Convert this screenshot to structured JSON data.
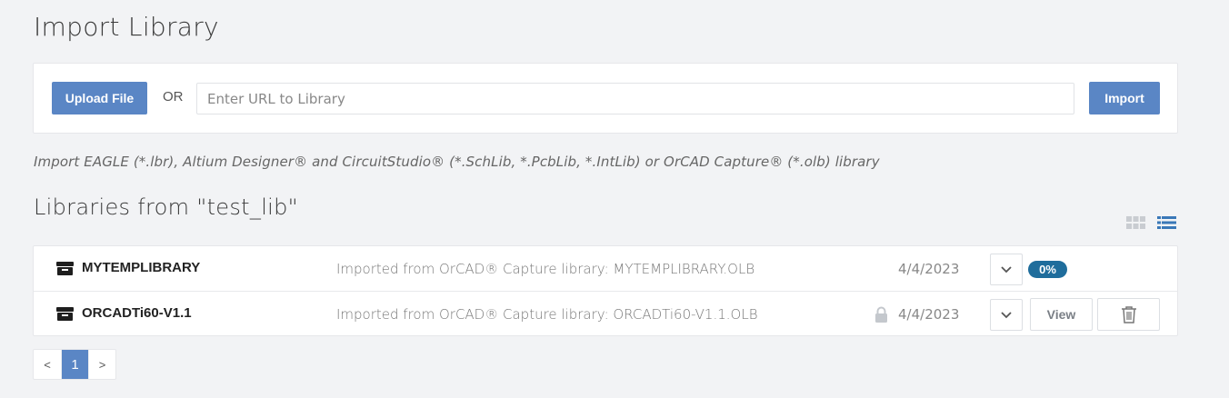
{
  "page": {
    "title": "Import Library"
  },
  "import": {
    "upload_label": "Upload File",
    "or_label": "OR",
    "url_placeholder": "Enter URL to Library",
    "url_value": "",
    "import_label": "Import",
    "hint": "Import EAGLE (*.lbr), Altium Designer® and CircuitStudio® (*.SchLib, *.PcbLib, *.IntLib) or OrCAD Capture® (*.olb) library"
  },
  "libraries": {
    "title": "Libraries from \"test_lib\"",
    "view_modes": [
      "grid-view-icon",
      "list-view-icon"
    ],
    "active_view": "list",
    "items": [
      {
        "name": "MYTEMPLIBRARY",
        "description": "Imported from OrCAD® Capture library: MYTEMPLIBRARY.OLB",
        "date": "4/4/2023",
        "locked": false,
        "progress": "0%"
      },
      {
        "name": "ORCADTi60-V1.1",
        "description": "Imported from OrCAD® Capture library: ORCADTi60-V1.1.OLB",
        "date": "4/4/2023",
        "locked": true,
        "view_label": "View"
      }
    ]
  },
  "pagination": {
    "prev": "<",
    "current": "1",
    "next": ">"
  },
  "colors": {
    "primary": "#5a86c5",
    "badge": "#1f6d9c",
    "background": "#f2f3f5"
  }
}
